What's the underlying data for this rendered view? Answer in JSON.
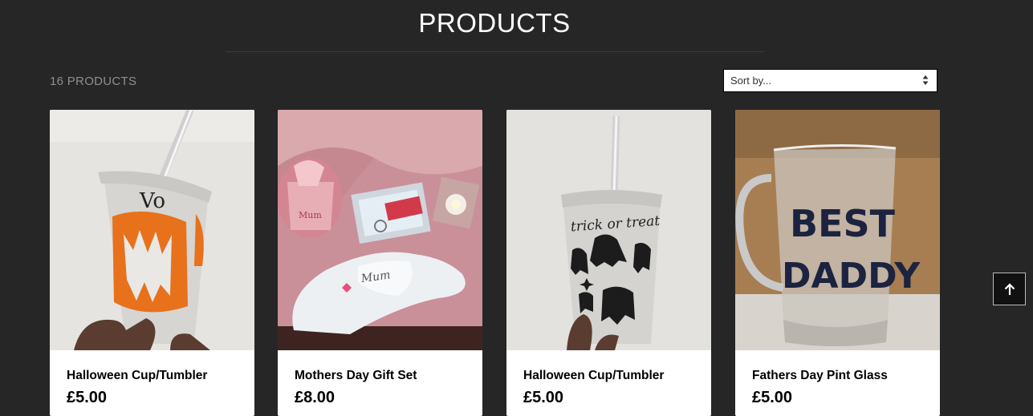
{
  "header": {
    "title": "PRODUCTS"
  },
  "toolbar": {
    "count_label": "16 PRODUCTS",
    "sort_value": "Sort by..."
  },
  "products": [
    {
      "name": "Halloween Cup/Tumbler",
      "price": "£5.00"
    },
    {
      "name": "Mothers Day Gift Set",
      "price": "£8.00"
    },
    {
      "name": "Halloween Cup/Tumbler",
      "price": "£5.00"
    },
    {
      "name": "Fathers Day Pint Glass",
      "price": "£5.00"
    }
  ],
  "photo_text": {
    "cup1": "Vo",
    "giftset_mug": "Mum",
    "giftset_slipper": "Mum",
    "cup2": "trick or treat",
    "glass_line1": "BEST",
    "glass_line2": "DADDY"
  },
  "icons": {
    "sort": "updown-icon",
    "back_to_top": "arrow-up-icon"
  },
  "colors": {
    "background": "#262626",
    "card": "#ffffff",
    "pumpkin": "#e8711c"
  }
}
